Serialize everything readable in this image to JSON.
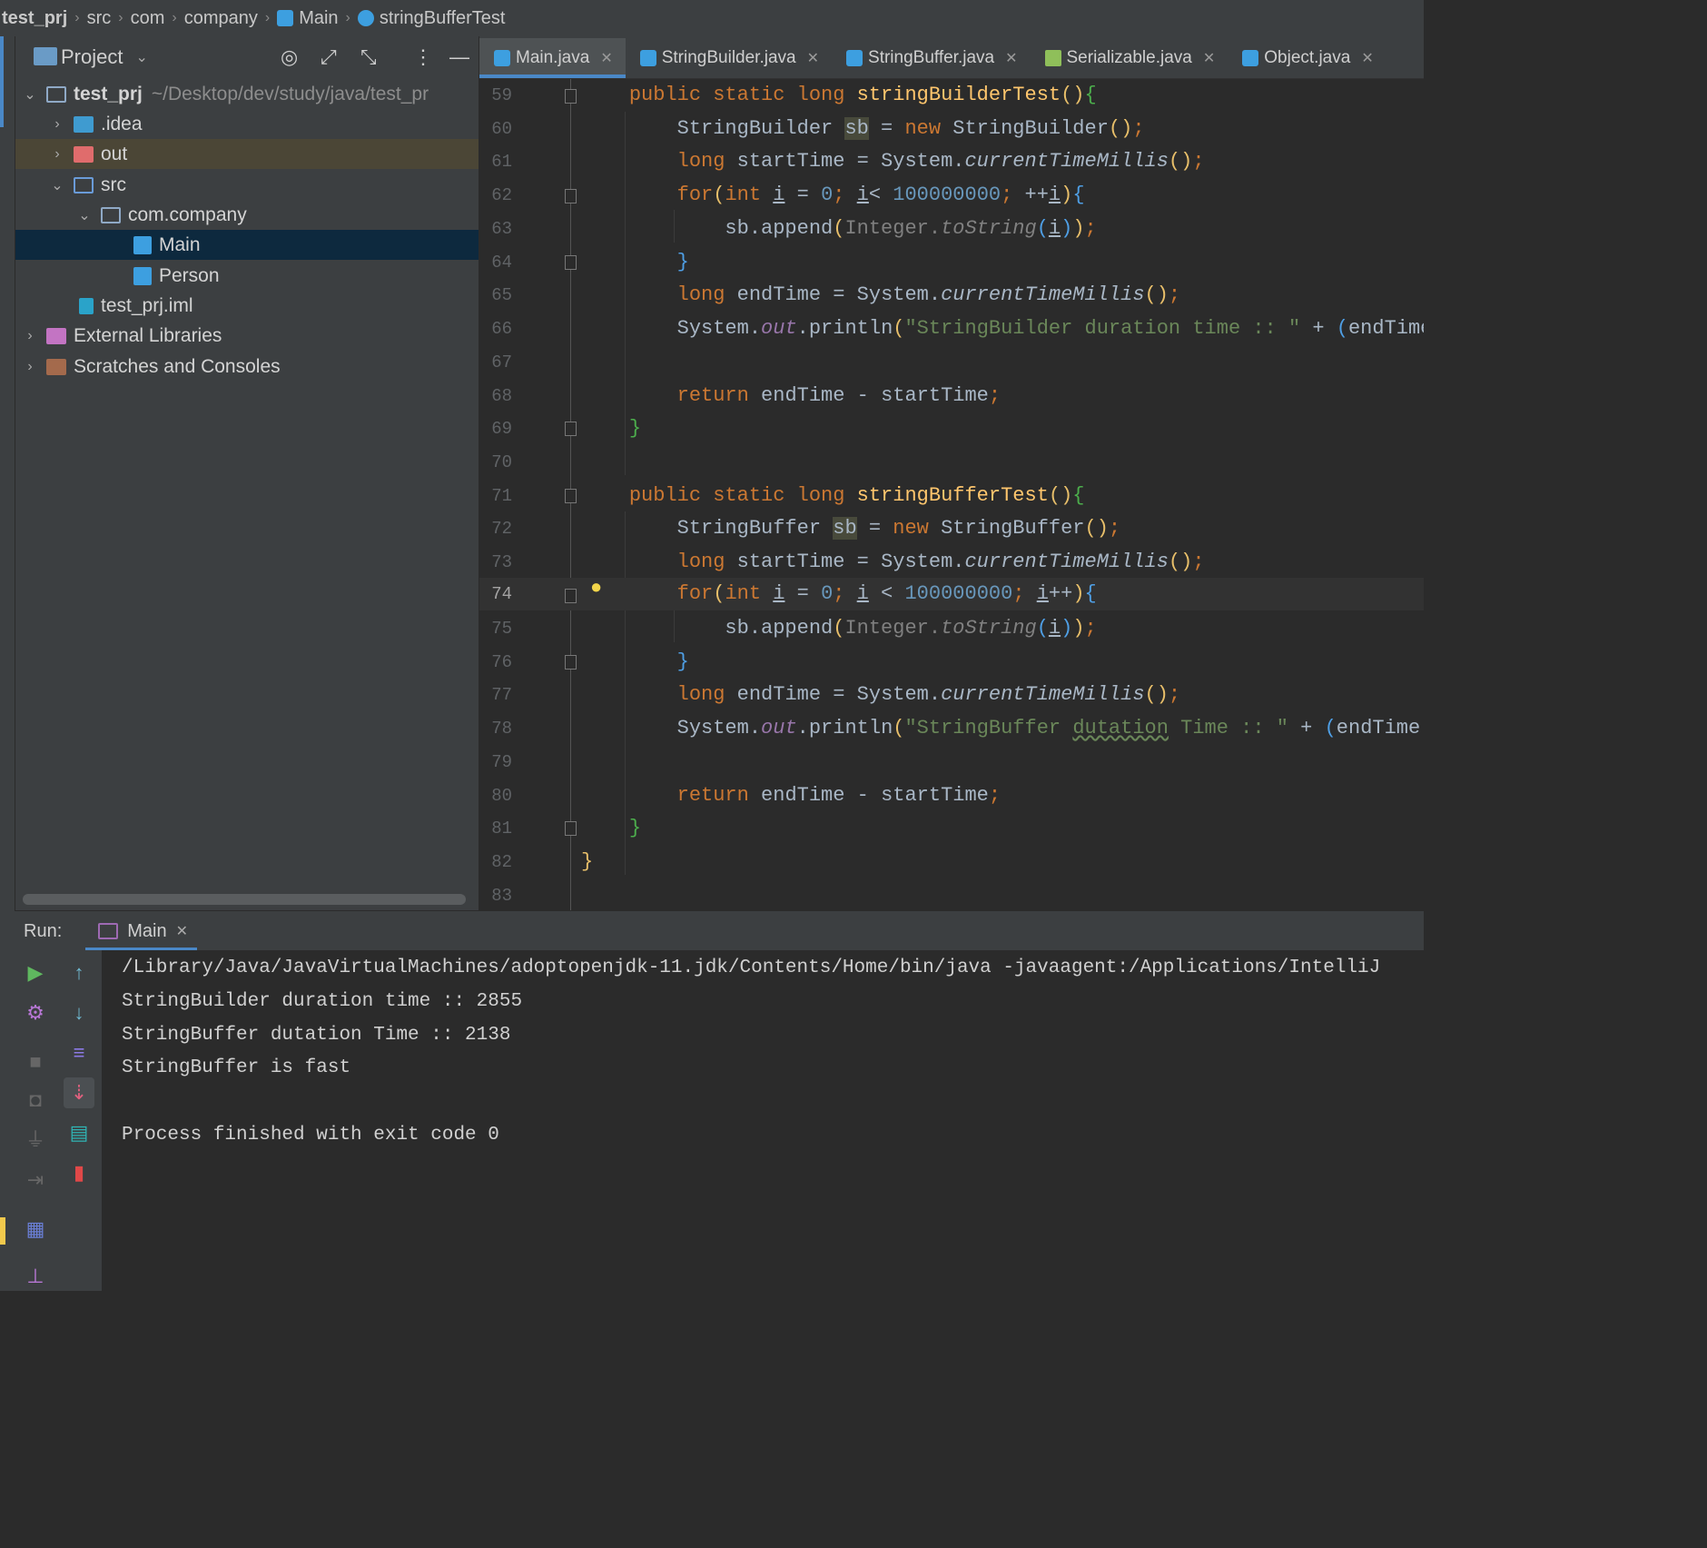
{
  "breadcrumb": [
    "test_prj",
    "src",
    "com",
    "company",
    "Main",
    "stringBufferTest"
  ],
  "project_panel": {
    "title": "Project",
    "tree": [
      {
        "label": "test_prj",
        "path": "~/Desktop/dev/study/java/test_pr"
      },
      {
        "label": ".idea"
      },
      {
        "label": "out"
      },
      {
        "label": "src"
      },
      {
        "label": "com.company"
      },
      {
        "label": "Main"
      },
      {
        "label": "Person"
      },
      {
        "label": "test_prj.iml"
      },
      {
        "label": "External Libraries"
      },
      {
        "label": "Scratches and Consoles"
      }
    ]
  },
  "tabs": [
    "Main.java",
    "StringBuilder.java",
    "StringBuffer.java",
    "Serializable.java",
    "Object.java"
  ],
  "editor": {
    "line_numbers": [
      "59",
      "60",
      "61",
      "62",
      "63",
      "64",
      "65",
      "66",
      "67",
      "68",
      "69",
      "70",
      "71",
      "72",
      "73",
      "74",
      "75",
      "76",
      "77",
      "78",
      "79",
      "80",
      "81",
      "82",
      "83"
    ],
    "current_line": "74"
  },
  "run_panel": {
    "label": "Run:",
    "tab": "Main",
    "console": [
      "/Library/Java/JavaVirtualMachines/adoptopenjdk-11.jdk/Contents/Home/bin/java -javaagent:/Applications/IntelliJ",
      "StringBuilder duration time :: 2855",
      "StringBuffer dutation Time :: 2138",
      "StringBuffer is fast",
      "",
      "Process finished with exit code 0"
    ]
  },
  "colors": {
    "keyword": "#cc7832",
    "method": "#ffc66d",
    "number": "#6897bb",
    "string": "#6a8759",
    "selection": "#0d293e",
    "accent": "#4a88c7"
  }
}
